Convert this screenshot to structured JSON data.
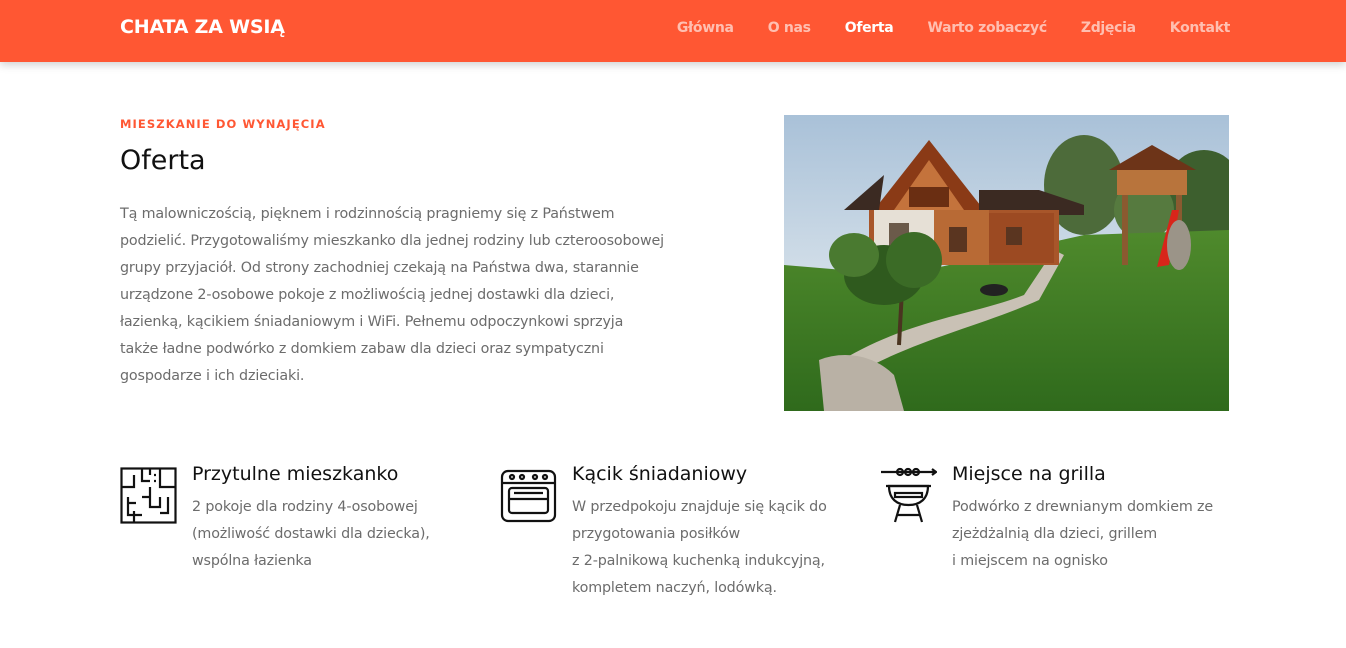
{
  "header": {
    "brand": "CHATA ZA WSIĄ",
    "nav": [
      {
        "label": "Główna",
        "active": false
      },
      {
        "label": "O nas",
        "active": false
      },
      {
        "label": "Oferta",
        "active": true
      },
      {
        "label": "Warto zobaczyć",
        "active": false
      },
      {
        "label": "Zdjęcia",
        "active": false
      },
      {
        "label": "Kontakt",
        "active": false
      }
    ]
  },
  "intro": {
    "eyebrow": "MIESZKANIE DO WYNAJĘCIA",
    "title": "Oferta",
    "text": "Tą malowniczością, pięknem i rodzinnością pragniemy się z Państwem podzielić. Przygotowaliśmy mieszkanko dla jednej rodziny lub czteroosobowej grupy przyjaciół. Od strony zachodniej czekają na Państwa dwa, starannie urządzone 2-osobowe pokoje z możliwością jednej dostawki dla dzieci, łazienką, kącikiem śniadaniowym i WiFi. Pełnemu odpoczynkowi sprzyja także ładne podwórko z domkiem zabaw dla dzieci oraz sympatyczni gospodarze i ich dzieciaki."
  },
  "features": [
    {
      "icon": "floor-plan-icon",
      "title": "Przytulne mieszkanko",
      "lines": [
        "2 pokoje dla rodziny 4-osobowej",
        "(możliwość dostawki dla dziecka),",
        "wspólna łazienka"
      ]
    },
    {
      "icon": "stove-icon",
      "title": "Kącik śniadaniowy",
      "lines": [
        "W przedpokoju znajduje się kącik do",
        "przygotowania posiłków",
        "z 2-palnikową kuchenką indukcyjną,",
        "kompletem naczyń, lodówką."
      ]
    },
    {
      "icon": "grill-icon",
      "title": "Miejsce na grilla",
      "lines": [
        "Podwórko z drewnianym domkiem ze",
        "zjeżdżalnią dla dzieci, grillem",
        "i miejscem na ognisko"
      ]
    }
  ],
  "colors": {
    "accent": "#ff5733",
    "text_muted": "#6c6c6c",
    "heading": "#111111"
  }
}
